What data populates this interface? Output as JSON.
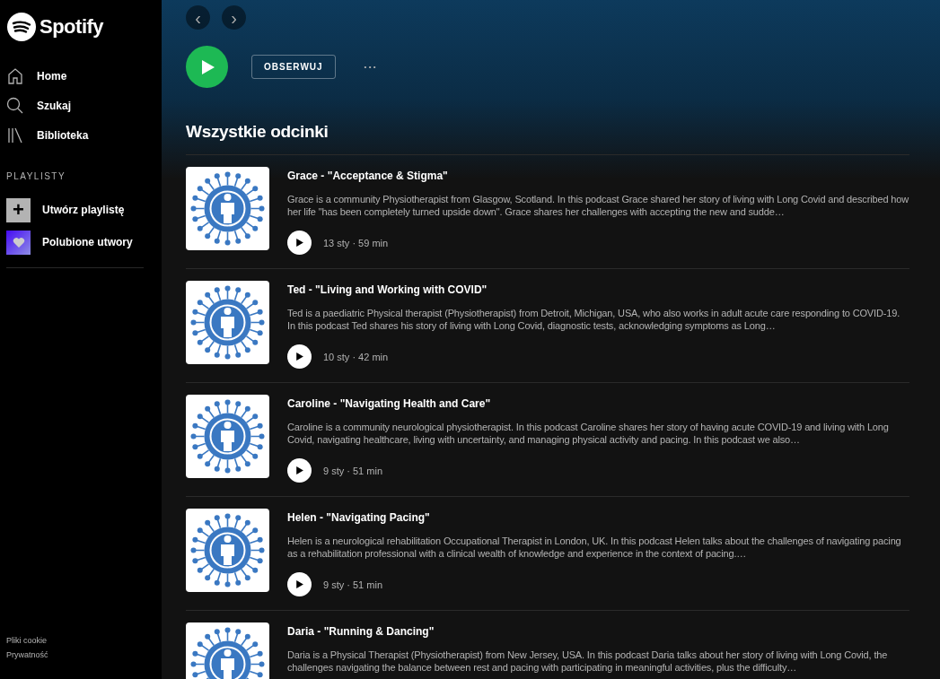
{
  "sidebar": {
    "logo": "Spotify",
    "nav": [
      {
        "kind": "home",
        "label": "Home"
      },
      {
        "kind": "search",
        "label": "Szukaj"
      },
      {
        "kind": "library",
        "label": "Biblioteka"
      }
    ],
    "playlists_heading": "PLAYLISTY",
    "playlist_actions": [
      {
        "kind": "create",
        "label": "Utwórz playlistę",
        "icon": "+"
      },
      {
        "kind": "liked",
        "label": "Polubione utwory"
      }
    ],
    "footer_links": [
      "Pliki cookie",
      "Prywatność"
    ]
  },
  "toolbar": {
    "back": "‹",
    "forward": "›"
  },
  "actions": {
    "follow_button": "OBSERWUJ",
    "more": "• • •"
  },
  "episodes_heading": "Wszystkie odcinki",
  "episodes": [
    {
      "title": "Grace - \"Acceptance & Stigma\"",
      "description": "Grace is a community Physiotherapist from Glasgow, Scotland. In this podcast Grace shared her story of living with Long Covid and described how her life \"has been completely turned upside down\". Grace shares her challenges with accepting the new and sudde…",
      "meta": "13 sty · 59 min"
    },
    {
      "title": "Ted - \"Living and Working with COVID\"",
      "description": "Ted is a paediatric Physical therapist (Physiotherapist) from Detroit, Michigan, USA, who also works in adult acute care responding to COVID-19. In this podcast Ted shares his story of living with Long Covid, diagnostic tests, acknowledging symptoms as Long…",
      "meta": "10 sty · 42 min"
    },
    {
      "title": "Caroline - \"Navigating Health and Care\"",
      "description": "Caroline is a community neurological physiotherapist. In this podcast Caroline shares her story of having acute COVID-19 and living with Long Covid, navigating healthcare, living with uncertainty, and managing physical activity and pacing. In this podcast we also…",
      "meta": "9 sty · 51 min"
    },
    {
      "title": "Helen - \"Navigating Pacing\"",
      "description": "Helen is a neurological rehabilitation Occupational Therapist in London, UK. In this podcast Helen talks about the challenges of navigating pacing as a rehabilitation professional with a clinical wealth of knowledge and experience in the context of pacing.…",
      "meta": "9 sty · 51 min"
    },
    {
      "title": "Daria - \"Running & Dancing\"",
      "description": "Daria is a Physical Therapist (Physiotherapist) from New Jersey, USA. In this podcast Daria talks about her story of living with Long Covid, the challenges navigating the balance between rest and pacing with participating in meaningful activities, plus the difficulty…"
    }
  ]
}
